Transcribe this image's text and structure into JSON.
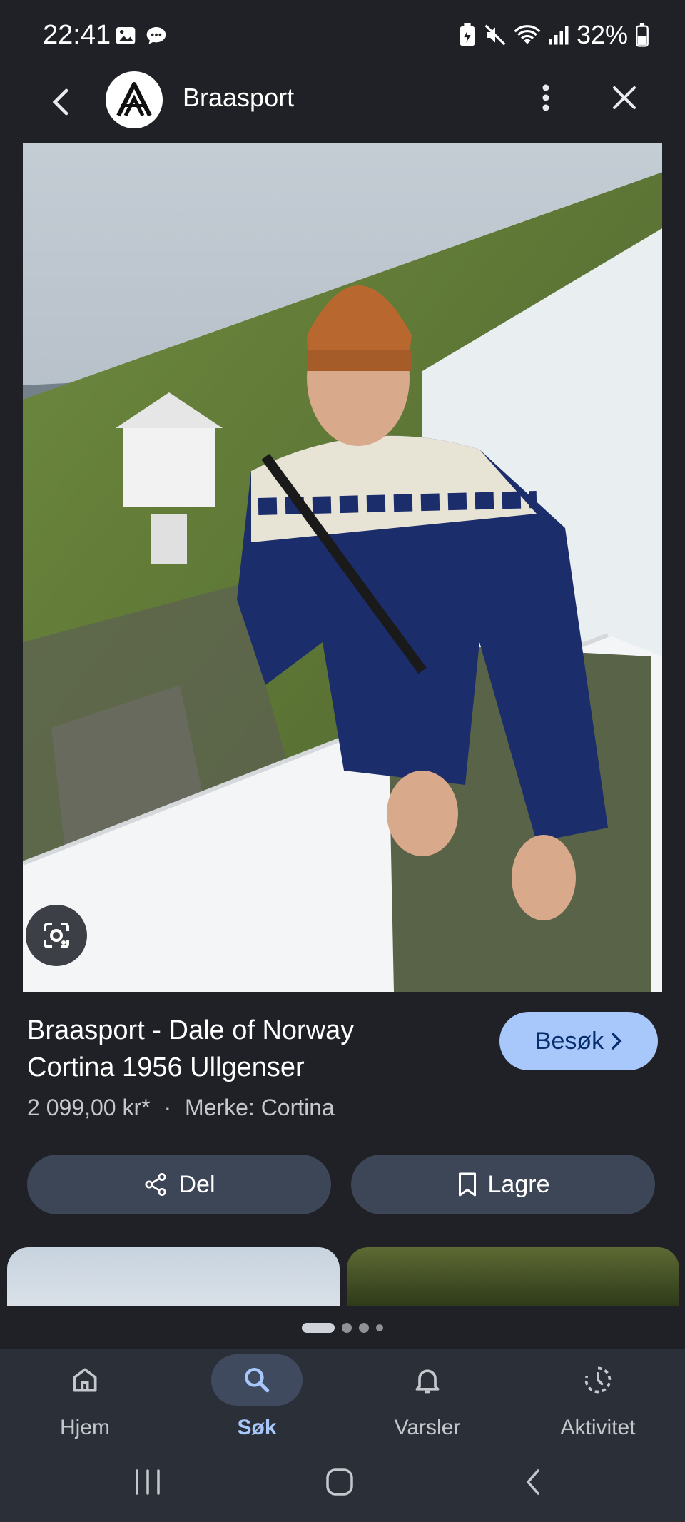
{
  "status_bar": {
    "time": "22:41",
    "battery": "32%"
  },
  "header": {
    "title": "Braasport"
  },
  "product": {
    "title_line1": "Braasport - Dale of Norway",
    "title_line2": "Cortina 1956 Ullgenser",
    "price": "2 099,00 kr*",
    "separator": "·",
    "brand": "Merke: Cortina",
    "visit_label": "Besøk"
  },
  "actions": {
    "share_label": "Del",
    "save_label": "Lagre"
  },
  "bottom_nav": {
    "items": [
      {
        "label": "Hjem",
        "icon": "home-icon"
      },
      {
        "label": "Søk",
        "icon": "search-icon"
      },
      {
        "label": "Varsler",
        "icon": "bell-icon"
      },
      {
        "label": "Aktivitet",
        "icon": "activity-icon"
      }
    ],
    "active": "Søk"
  },
  "colors": {
    "accent": "#a8c7fa",
    "background": "#1f2127",
    "button": "#3d4656"
  }
}
